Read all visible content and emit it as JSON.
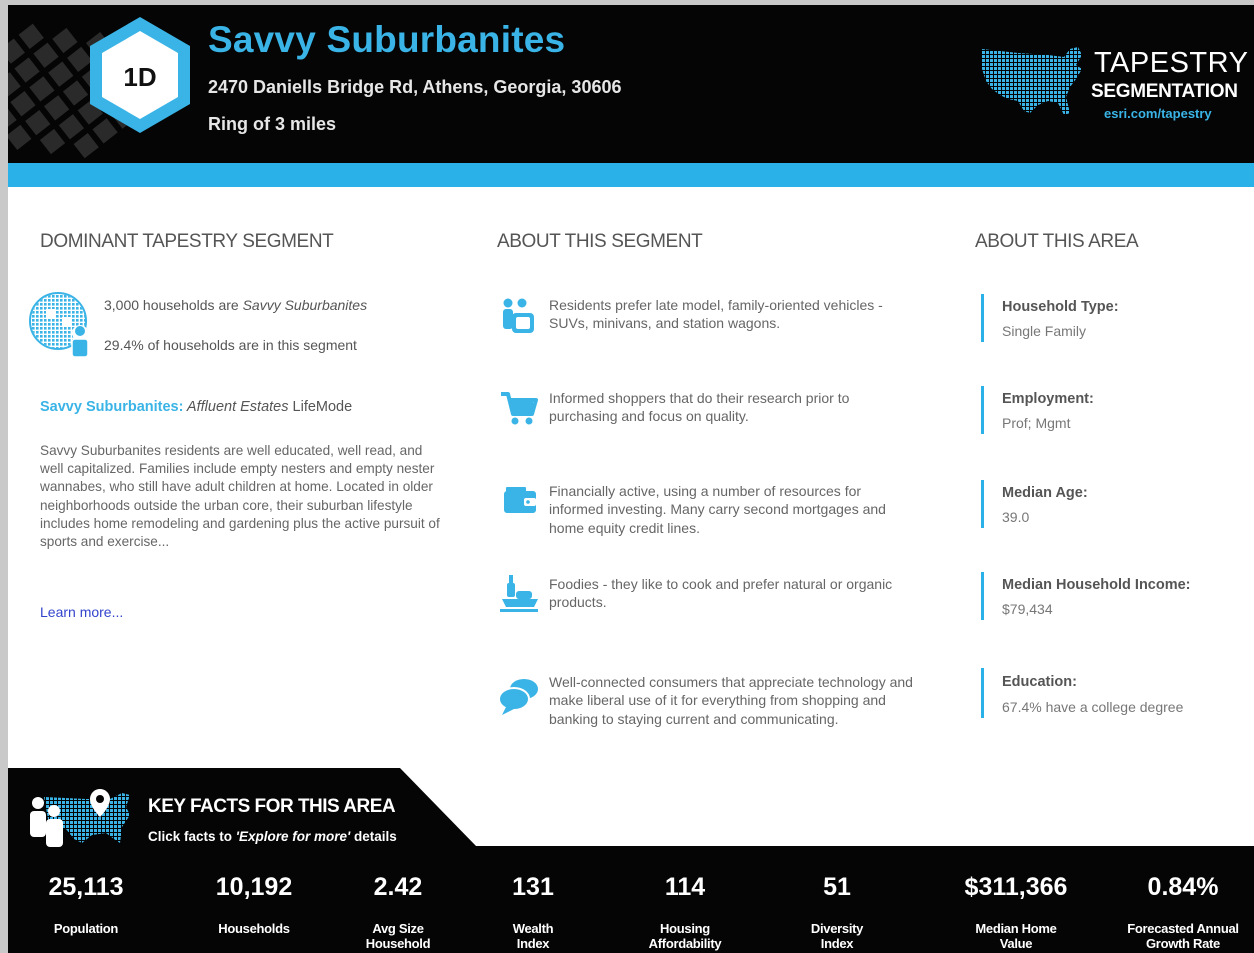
{
  "header": {
    "badge": "1D",
    "title": "Savvy Suburbanites",
    "address": "2470 Daniells Bridge Rd, Athens, Georgia, 30606",
    "ring": "Ring of 3 miles",
    "brand_line1": "TAPESTRY",
    "brand_line2": "SEGMENTATION",
    "brand_url": "esri.com/tapestry"
  },
  "dominant": {
    "heading": "DOMINANT TAPESTRY SEGMENT",
    "households_count": "3,000",
    "households_text": " households are ",
    "households_segment": "Savvy Suburbanites",
    "percent": "29.4%",
    "percent_text": " of households are in this segment",
    "mode_name": "Savvy Suburbanites:",
    "mode_life": " Affluent Estates",
    "mode_rest": " LifeMode",
    "description": "Savvy Suburbanites residents are well educated, well read, and well capitalized. Families include empty nesters and empty nester wannabes, who still have adult children at home. Located in older neighborhoods outside the urban core, their suburban lifestyle includes home remodeling and gardening plus the active pursuit of sports and exercise...",
    "learn_more": "Learn more..."
  },
  "segment": {
    "heading": "ABOUT THIS SEGMENT",
    "items": [
      {
        "icon": "family-icon",
        "text": "Residents prefer late model, family-oriented vehicles - SUVs, minivans, and station wagons."
      },
      {
        "icon": "shopping-cart-icon",
        "text": "Informed shoppers that do their research prior to purchasing and focus on quality."
      },
      {
        "icon": "wallet-icon",
        "text": "Financially active, using a number of resources for informed investing. Many carry second mortgages and home equity credit lines."
      },
      {
        "icon": "food-icon",
        "text": "Foodies - they like to cook and prefer natural or organic products."
      },
      {
        "icon": "chat-bubbles-icon",
        "text": "Well-connected consumers that appreciate technology and make liberal use of it for everything from shopping and banking to staying current and communicating."
      }
    ]
  },
  "area": {
    "heading": "ABOUT THIS AREA",
    "items": [
      {
        "label": "Household Type:",
        "value": "Single Family"
      },
      {
        "label": "Employment:",
        "value": "Prof; Mgmt"
      },
      {
        "label": "Median Age:",
        "value": "39.0"
      },
      {
        "label": "Median Household Income:",
        "value": "$79,434"
      },
      {
        "label": "Education:",
        "value": "67.4% have a college degree"
      }
    ]
  },
  "key_facts": {
    "title": "KEY FACTS FOR THIS AREA",
    "sub_prefix": "Click facts to ",
    "sub_link": "'Explore for more'",
    "sub_suffix": " details",
    "facts": [
      {
        "value": "25,113",
        "label1": "Population",
        "label2": ""
      },
      {
        "value": "10,192",
        "label1": "Households",
        "label2": ""
      },
      {
        "value": "2.42",
        "label1": "Avg Size",
        "label2": "Household"
      },
      {
        "value": "131",
        "label1": "Wealth",
        "label2": "Index"
      },
      {
        "value": "114",
        "label1": "Housing",
        "label2": "Affordability"
      },
      {
        "value": "51",
        "label1": "Diversity",
        "label2": "Index"
      },
      {
        "value": "$311,366",
        "label1": "Median Home",
        "label2": "Value"
      },
      {
        "value": "0.84%",
        "label1": "Forecasted Annual",
        "label2": "Growth Rate"
      }
    ]
  },
  "colors": {
    "accent": "#29b1e8",
    "title_blue": "#3ab4e6",
    "header_bg": "#050505",
    "link": "#3344cc"
  }
}
